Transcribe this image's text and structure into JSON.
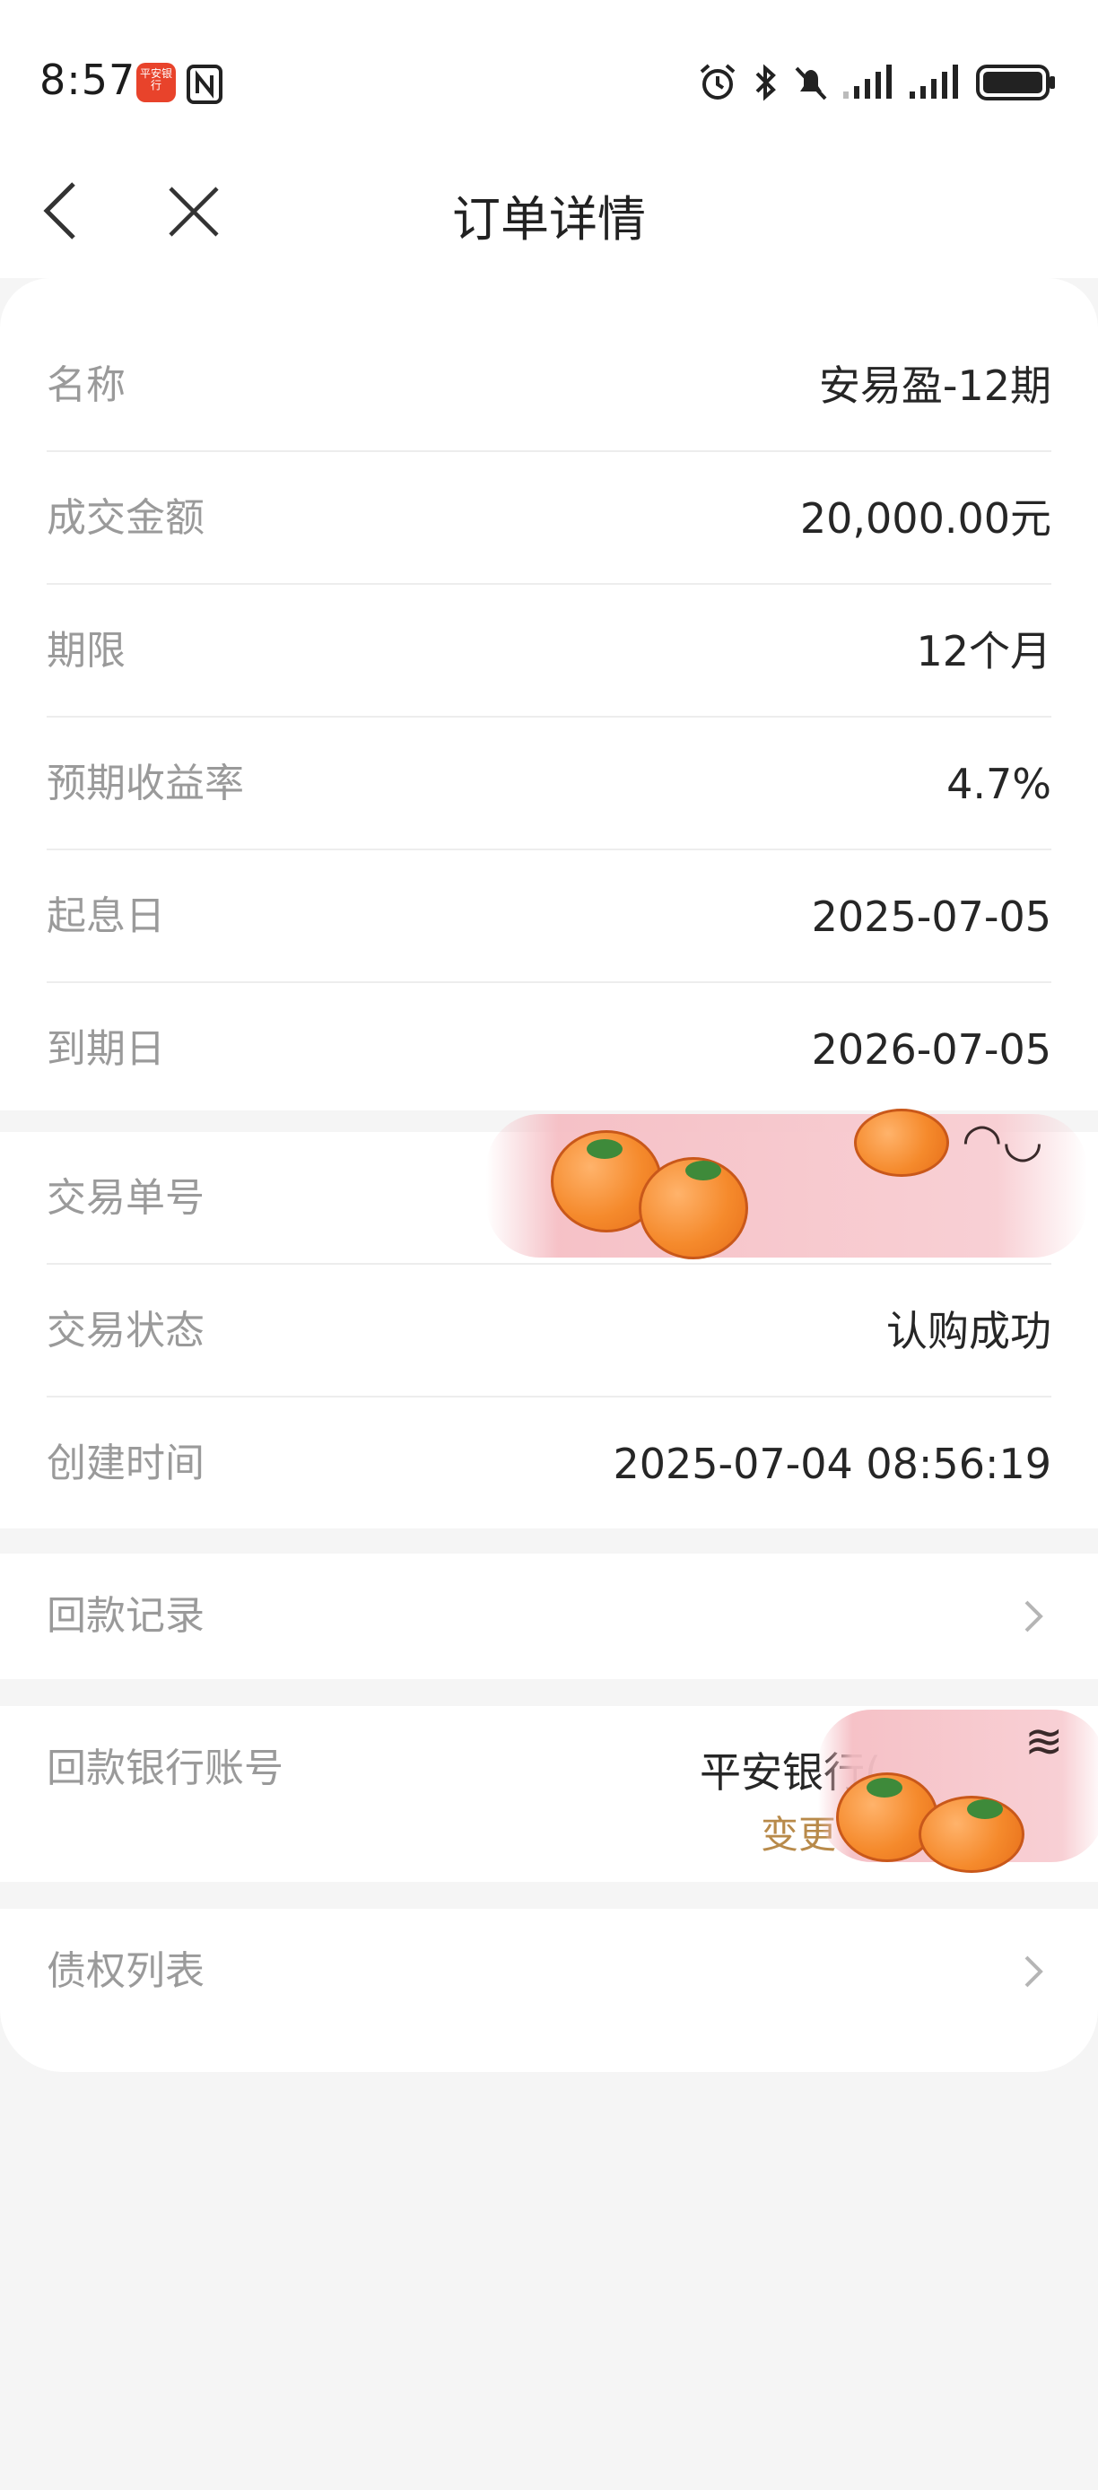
{
  "status_bar": {
    "time": "8:57",
    "app_badge": "平安银行",
    "icons": [
      "nfc-icon",
      "alarm-icon",
      "bluetooth-icon",
      "mute-icon",
      "signal-icon",
      "signal-icon",
      "battery-icon"
    ]
  },
  "nav": {
    "title": "订单详情",
    "back_icon": "chevron-left-icon",
    "close_icon": "close-icon"
  },
  "order": {
    "rows": [
      {
        "label": "名称",
        "value": "安易盈-12期"
      },
      {
        "label": "成交金额",
        "value": "20,000.00元"
      },
      {
        "label": "期限",
        "value": "12个月"
      },
      {
        "label": "预期收益率",
        "value": "4.7%"
      },
      {
        "label": "起息日",
        "value": "2025-07-05"
      },
      {
        "label": "到期日",
        "value": "2026-07-05"
      }
    ]
  },
  "transaction": {
    "rows": [
      {
        "label": "交易单号",
        "value": ""
      },
      {
        "label": "交易状态",
        "value": "认购成功"
      },
      {
        "label": "创建时间",
        "value": "2025-07-04 08:56:19"
      }
    ]
  },
  "repayment_record": {
    "label": "回款记录"
  },
  "repayment_account": {
    "label": "回款银行账号",
    "bank": "平安银行(",
    "change": "变更"
  },
  "claims_list": {
    "label": "债权列表"
  }
}
